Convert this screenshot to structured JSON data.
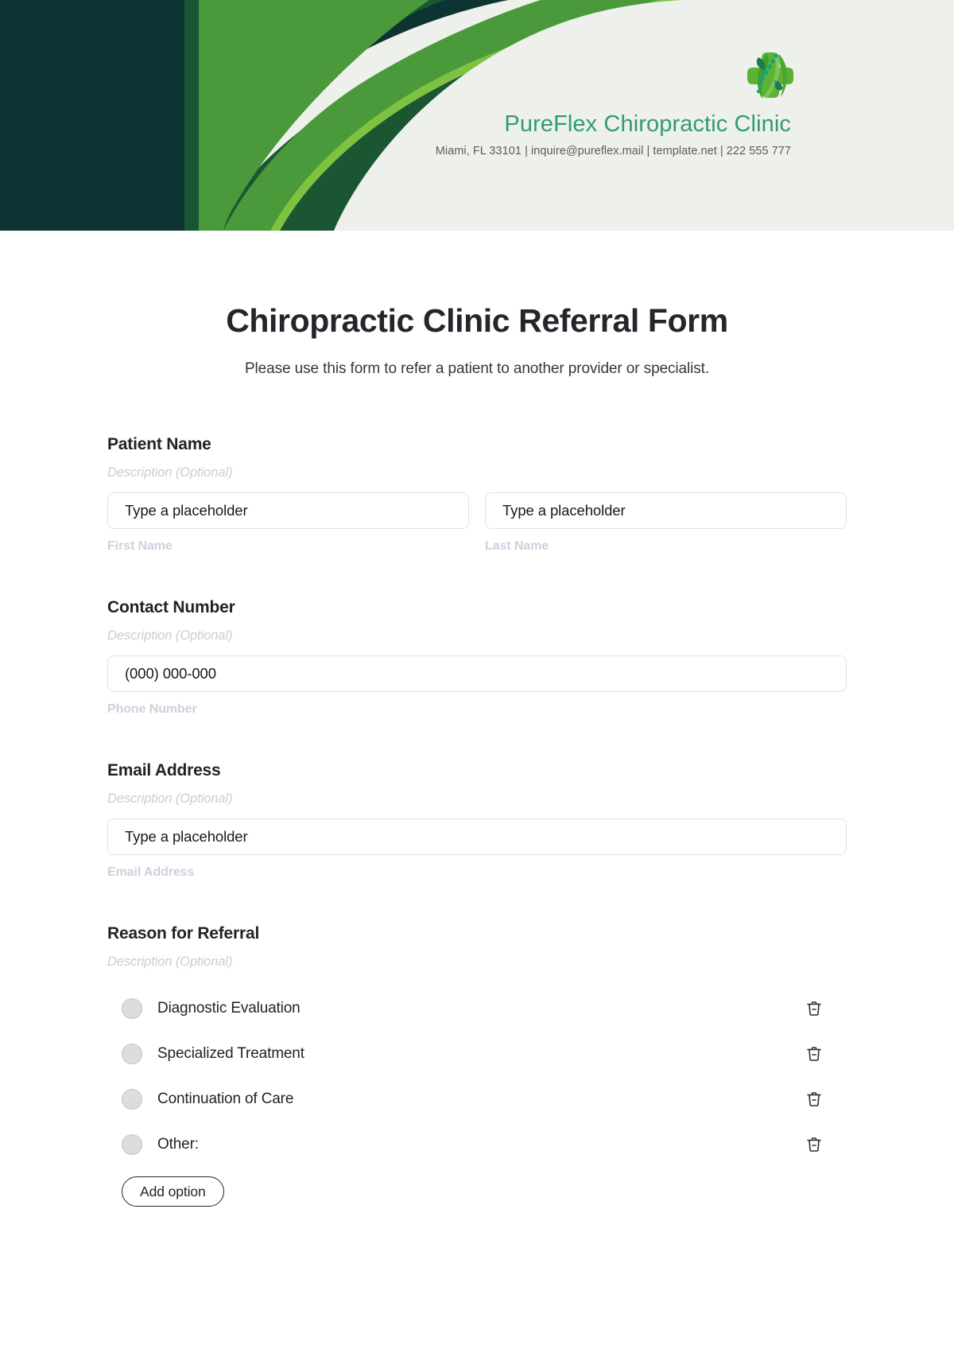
{
  "header": {
    "clinic_name": "PureFlex Chiropractic Clinic",
    "contact_line": "Miami, FL 33101 | inquire@pureflex.mail | template.net | 222 555 777",
    "colors": {
      "backdrop": "#eef0ec",
      "dark_teal": "#0d3433",
      "dark_green": "#1a5632",
      "mid_green": "#4a9a3c",
      "light_green": "#7fc241",
      "brand_text": "#2f9e68",
      "contact_text": "#595d5c"
    },
    "logo": {
      "icon": "spine-leaf-cross-icon",
      "leaf_dark": "#1f7a52",
      "leaf_mid": "#4aa32f",
      "leaf_light": "#6bbe3c",
      "dots": "#13a387"
    }
  },
  "form": {
    "title": "Chiropractic Clinic Referral Form",
    "subtitle": "Please use this form to refer a patient to another provider or specialist.",
    "description_placeholder": "Description (Optional)",
    "fields": [
      {
        "label": "Patient Name",
        "description": "Description (Optional)",
        "inputs": [
          {
            "value": "Type a placeholder",
            "sub_label": "First Name"
          },
          {
            "value": "Type a placeholder",
            "sub_label": "Last Name"
          }
        ]
      },
      {
        "label": "Contact Number",
        "description": "Description (Optional)",
        "inputs": [
          {
            "value": "(000) 000-000",
            "sub_label": "Phone Number"
          }
        ]
      },
      {
        "label": "Email Address",
        "description": "Description (Optional)",
        "inputs": [
          {
            "value": "Type a placeholder",
            "sub_label": "Email Address"
          }
        ]
      }
    ],
    "choice_field": {
      "label": "Reason for Referral",
      "description": "Description (Optional)",
      "options": [
        {
          "label": "Diagnostic Evaluation",
          "delete_icon": "trash-icon"
        },
        {
          "label": "Specialized Treatment",
          "delete_icon": "trash-icon"
        },
        {
          "label": "Continuation of Care",
          "delete_icon": "trash-icon"
        },
        {
          "label": "Other:",
          "delete_icon": "trash-icon"
        }
      ],
      "add_option_label": "Add option"
    }
  }
}
